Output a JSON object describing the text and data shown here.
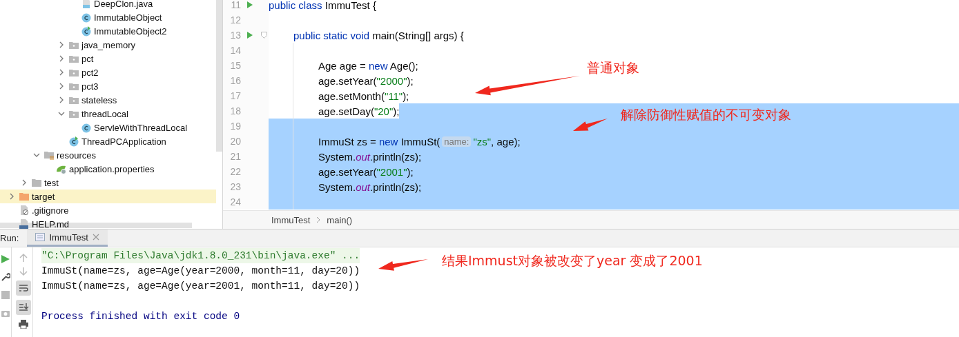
{
  "project_tree": [
    {
      "children": [
        {
          "children": [
            {
              "children": [
                {
                  "children": [
                    {
                      "children": [
                        {
                          "label": "DeepClon.java",
                          "kind": "java-file",
                          "selected": false
                        },
                        {
                          "label": "ImmutableObject",
                          "kind": "class",
                          "selected": false
                        },
                        {
                          "label": "ImmutableObject2",
                          "kind": "class-run",
                          "selected": false
                        }
                      ]
                    },
                    {
                      "label": "java_memory",
                      "kind": "package",
                      "expanded": false,
                      "selected": false
                    },
                    {
                      "label": "pct",
                      "kind": "package",
                      "expanded": false,
                      "selected": false
                    },
                    {
                      "label": "pct2",
                      "kind": "package",
                      "expanded": false,
                      "selected": false
                    },
                    {
                      "label": "pct3",
                      "kind": "package",
                      "expanded": false,
                      "selected": false
                    },
                    {
                      "label": "stateless",
                      "kind": "package",
                      "expanded": false,
                      "selected": false
                    },
                    {
                      "label": "threadLocal",
                      "kind": "package",
                      "expanded": true,
                      "selected": false,
                      "children": [
                        {
                          "label": "ServleWithThreadLocal",
                          "kind": "class",
                          "selected": false
                        }
                      ]
                    },
                    {
                      "label": "ThreadPCApplication",
                      "kind": "spring-class",
                      "selected": false
                    }
                  ]
                }
              ]
            },
            {
              "label": "resources",
              "kind": "resources-folder",
              "expanded": true,
              "selected": false,
              "children": [
                {
                  "label": "application.properties",
                  "kind": "spring-file",
                  "selected": false
                }
              ]
            }
          ]
        },
        {
          "label": "test",
          "kind": "folder",
          "expanded": false,
          "selected": false
        }
      ]
    },
    {
      "label": "target",
      "kind": "excluded-folder",
      "expanded": false,
      "selected": true
    },
    {
      "label": ".gitignore",
      "kind": "ignore-file",
      "selected": false
    },
    {
      "label": "HELP.md",
      "kind": "md-file",
      "selected": false
    }
  ],
  "editor": {
    "lines": [
      {
        "number": "11",
        "run": true,
        "selected": false,
        "tokens": [
          {
            "kind": "kw",
            "text": "public class"
          },
          {
            "kind": "plain",
            "text": " ImmuTest {"
          }
        ]
      },
      {
        "number": "12",
        "selected": false
      },
      {
        "number": "13",
        "run": true,
        "fold": true,
        "selected": false,
        "tokens": [
          {
            "kind": "kw",
            "text": "    public static void"
          },
          {
            "kind": "plain",
            "text": " main(String[] args) {"
          }
        ]
      },
      {
        "number": "14",
        "selected": false
      },
      {
        "number": "15",
        "selected": false,
        "tokens": [
          {
            "kind": "plain",
            "text": "        Age age = "
          },
          {
            "kind": "kw",
            "text": "new"
          },
          {
            "kind": "plain",
            "text": " Age();"
          }
        ]
      },
      {
        "number": "16",
        "selected": false,
        "tokens": [
          {
            "kind": "plain",
            "text": "        age.setYear("
          },
          {
            "kind": "str",
            "text": "\"2000\""
          },
          {
            "kind": "plain",
            "text": ");"
          }
        ]
      },
      {
        "number": "17",
        "selected": false,
        "tokens": [
          {
            "kind": "plain",
            "text": "        age.setMonth("
          },
          {
            "kind": "str",
            "text": "\"11\""
          },
          {
            "kind": "plain",
            "text": ");"
          }
        ]
      },
      {
        "number": "18",
        "selected": true,
        "tokens": [
          {
            "kind": "plain",
            "text": "        age.setDay("
          },
          {
            "kind": "str",
            "text": "\"20\""
          },
          {
            "kind": "plain",
            "text": ");"
          }
        ]
      },
      {
        "number": "19",
        "selected": true
      },
      {
        "number": "20",
        "selected": true,
        "tokens": [
          {
            "kind": "plain",
            "text": "        ImmuSt zs = "
          },
          {
            "kind": "kw",
            "text": "new"
          },
          {
            "kind": "plain",
            "text": " ImmuSt("
          },
          {
            "kind": "hint",
            "text": "name:"
          },
          {
            "kind": "str",
            "text": "\"zs\""
          },
          {
            "kind": "plain",
            "text": ", age);"
          }
        ]
      },
      {
        "number": "21",
        "selected": true,
        "tokens": [
          {
            "kind": "plain",
            "text": "        System."
          },
          {
            "kind": "field",
            "text": "out"
          },
          {
            "kind": "plain",
            "text": ".println(zs);"
          }
        ]
      },
      {
        "number": "22",
        "selected": true,
        "tokens": [
          {
            "kind": "plain",
            "text": "        age.setYear("
          },
          {
            "kind": "str",
            "text": "\"2001\""
          },
          {
            "kind": "plain",
            "text": ");"
          }
        ]
      },
      {
        "number": "23",
        "selected": true,
        "tokens": [
          {
            "kind": "plain",
            "text": "        System."
          },
          {
            "kind": "field",
            "text": "out"
          },
          {
            "kind": "plain",
            "text": ".println(zs);"
          }
        ]
      },
      {
        "number": "24",
        "selected": true
      }
    ],
    "breadcrumbs": [
      "ImmuTest",
      "main()"
    ]
  },
  "run_panel": {
    "label": "Run:",
    "tabs": [
      {
        "label": "ImmuTest",
        "selected": true
      }
    ],
    "console": [
      {
        "kind": "command",
        "text": "\"C:\\Program Files\\Java\\jdk1.8.0_231\\bin\\java.exe\" ..."
      },
      {
        "kind": "output",
        "text": "ImmuSt(name=zs, age=Age(year=2000, month=11, day=20))"
      },
      {
        "kind": "output",
        "text": "ImmuSt(name=zs, age=Age(year=2001, month=11, day=20))"
      },
      {
        "kind": "blank"
      },
      {
        "kind": "system",
        "text": "Process finished with exit code 0"
      }
    ]
  },
  "annotations": [
    {
      "text": "普通对象"
    },
    {
      "text": "解除防御性赋值的不可变对象"
    },
    {
      "text": "结果Immust对象被改变了year 变成了2001"
    }
  ]
}
